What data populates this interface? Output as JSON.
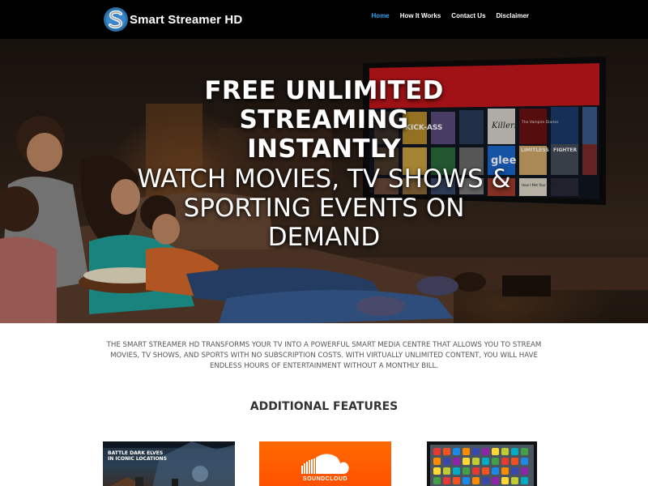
{
  "brand": {
    "name": "Smart Streamer HD",
    "accent": "#2ea3f2",
    "logo_icon": "s-logo-icon"
  },
  "nav": {
    "items": [
      {
        "label": "Home",
        "active": true
      },
      {
        "label": "How It Works",
        "active": false
      },
      {
        "label": "Contact Us",
        "active": false
      },
      {
        "label": "Disclaimer",
        "active": false
      }
    ]
  },
  "hero": {
    "title_lines": [
      "FREE UNLIMITED",
      "STREAMING",
      "INSTANTLY"
    ],
    "subtitle_lines": [
      "WATCH MOVIES, TV SHOWS &",
      "SPORTING EVENTS ON",
      "DEMAND"
    ],
    "tv_posters": [
      "KICK-ASS",
      "Killers",
      "The Vampire Diaries",
      "glee",
      "LIMITLESS",
      "FIGHTER",
      "How I Met Your Mother"
    ]
  },
  "intro": {
    "text": "THE SMART STREAMER HD TRANSFORMS YOUR TV INTO A POWERFUL SMART MEDIA CENTRE THAT ALLOWS YOU TO STREAM MOVIES, TV SHOWS, AND SPORTS WITH NO SUBSCRIPTION COSTS. WITH VIRTUALLY UNLIMITED CONTENT, YOU WILL HAVE ENDLESS HOURS OF ENTERTAINMENT WITHOUT A MONTHLY BILL."
  },
  "features": {
    "heading": "ADDITIONAL FEATURES",
    "cards": [
      {
        "caption_lines": [
          "BATTLE DARK ELVES",
          "IN ICONIC LOCATIONS"
        ]
      },
      {
        "label": "SOUNDCLOUD",
        "icon": "soundcloud-cloud-icon"
      },
      {
        "icon": "app-grid-icon"
      }
    ]
  }
}
